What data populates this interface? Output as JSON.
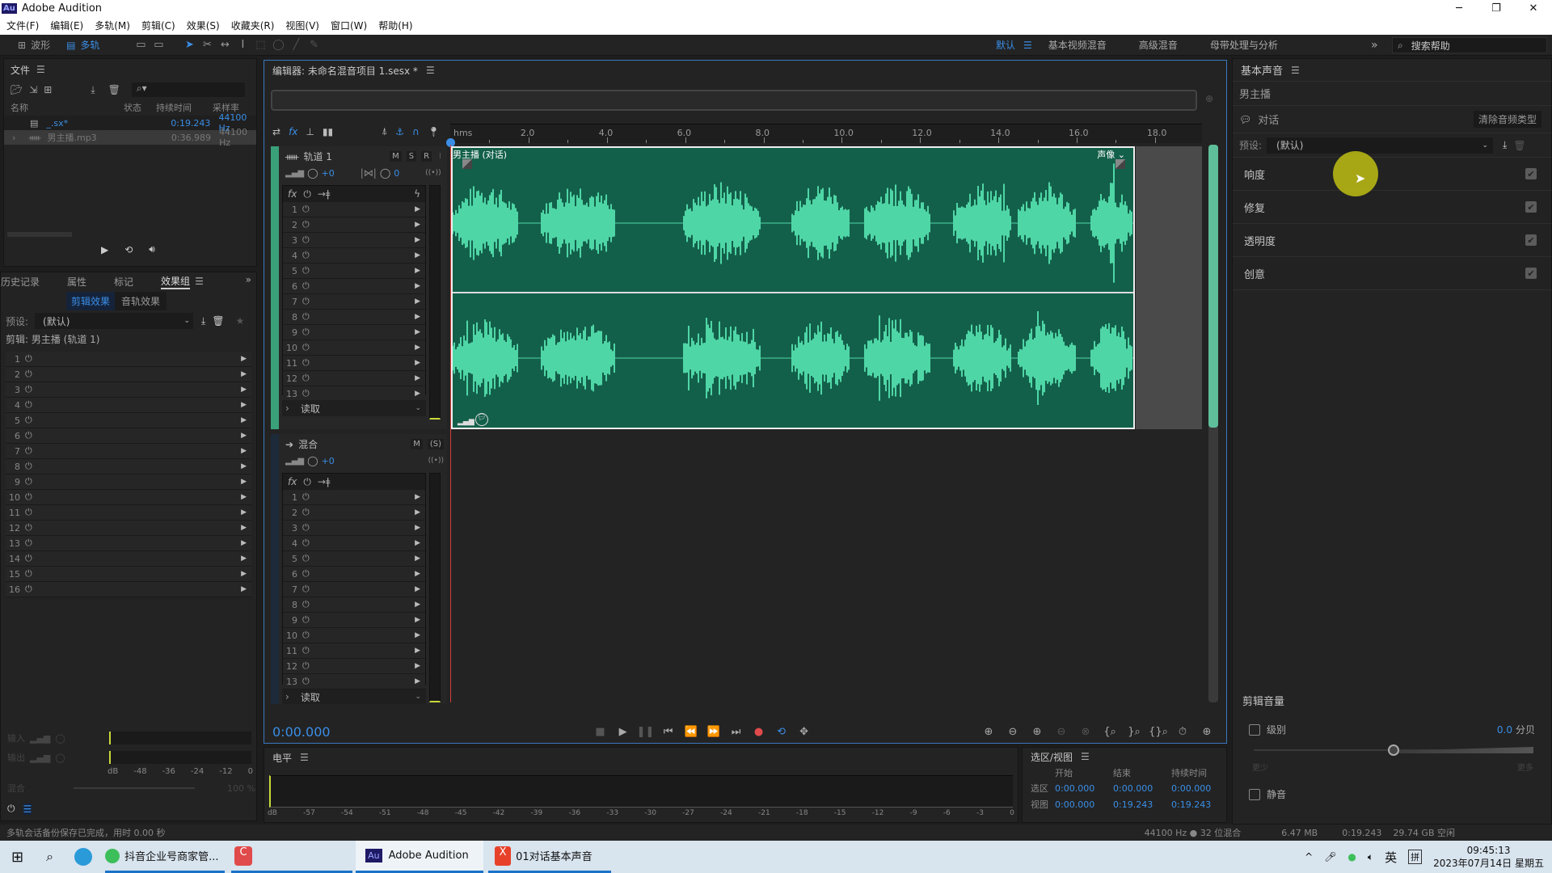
{
  "app": {
    "title": "Adobe Audition",
    "logo": "Au"
  },
  "window_controls": {
    "minimize": "─",
    "restore": "❐",
    "close": "✕"
  },
  "menu": [
    "文件(F)",
    "编辑(E)",
    "多轨(M)",
    "剪辑(C)",
    "效果(S)",
    "收藏夹(R)",
    "视图(V)",
    "窗口(W)",
    "帮助(H)"
  ],
  "toolbar": {
    "waveform_label": "波形",
    "multitrack_label": "多轨",
    "workspaces": [
      "默认",
      "基本视频混音",
      "高级混音",
      "母带处理与分析"
    ],
    "active_workspace": "默认",
    "more": "»",
    "search_placeholder": "搜索帮助"
  },
  "files_panel": {
    "title": "文件",
    "columns": [
      "名称",
      "状态",
      "持续时间",
      "采样率"
    ],
    "items": [
      {
        "name": "_.sx*",
        "duration": "0:19.243",
        "rate": "44100 Hz",
        "type": "multitrack",
        "selected": true
      },
      {
        "name": "男主播.mp3",
        "duration": "0:36.989",
        "rate": "44100 Hz",
        "type": "audio",
        "selected": false
      }
    ]
  },
  "left_tabs": {
    "tabs": [
      "历史记录",
      "属性",
      "标记",
      "效果组"
    ],
    "active": "效果组",
    "subtabs": [
      "剪辑效果",
      "音轨效果"
    ],
    "active_subtab": "剪辑效果",
    "preset_label": "预设:",
    "preset_value": "(默认)",
    "clip_label": "剪辑: 男主播 (轨道 1)",
    "slots": [
      "1",
      "2",
      "3",
      "4",
      "5",
      "6",
      "7",
      "8",
      "9",
      "10",
      "11",
      "12",
      "13",
      "14",
      "15",
      "16"
    ],
    "input_label": "输入",
    "output_label": "输出",
    "mix_label": "混合",
    "mix_value": "100 %",
    "meter_scale": [
      "dB",
      "-48",
      "-36",
      "-24",
      "-12",
      "0"
    ]
  },
  "status_message": "多轨会话备份保存已完成，用时 0.00 秒",
  "editor": {
    "title": "编辑器: 未命名混音项目 1.sesx *",
    "ruler_unit": "hms",
    "ruler_labels": [
      "2.0",
      "4.0",
      "6.0",
      "8.0",
      "10.0",
      "12.0",
      "14.0",
      "16.0",
      "18.0"
    ],
    "track1": {
      "name": "轨道 1",
      "m": "M",
      "s": "S",
      "r": "R",
      "i": "I",
      "volume": "+0",
      "pan": "0",
      "slots": [
        "1",
        "2",
        "3",
        "4",
        "5",
        "6",
        "7",
        "8",
        "9",
        "10",
        "11",
        "12",
        "13"
      ],
      "read_mode": "读取"
    },
    "clip": {
      "name": "男主播 (对话)",
      "pan_label": "声像"
    },
    "mix": {
      "name": "混合",
      "m": "M",
      "s": "(S)",
      "volume": "+0",
      "slots": [
        "1",
        "2",
        "3",
        "4",
        "5",
        "6",
        "7",
        "8",
        "9",
        "10",
        "11",
        "12",
        "13"
      ],
      "read_mode": "读取"
    },
    "time": "0:00.000"
  },
  "levels_panel": {
    "title": "电平",
    "scale": [
      "dB",
      "-57",
      "-54",
      "-51",
      "-48",
      "-45",
      "-42",
      "-39",
      "-36",
      "-33",
      "-30",
      "-27",
      "-24",
      "-21",
      "-18",
      "-15",
      "-12",
      "-9",
      "-6",
      "-3",
      "0"
    ]
  },
  "selection_panel": {
    "title": "选区/视图",
    "columns": [
      "开始",
      "结束",
      "持续时间"
    ],
    "rows": [
      {
        "label": "选区",
        "start": "0:00.000",
        "end": "0:00.000",
        "duration": "0:00.000"
      },
      {
        "label": "视图",
        "start": "0:00.000",
        "end": "0:19.243",
        "duration": "0:19.243"
      }
    ]
  },
  "essential_sound": {
    "title": "基本声音",
    "clip_name": "男主播",
    "type_label": "对话",
    "clear_button": "清除音频类型",
    "preset_label": "预设:",
    "preset_value": "(默认)",
    "sections": [
      {
        "label": "响度",
        "checked": true
      },
      {
        "label": "修复",
        "checked": true
      },
      {
        "label": "透明度",
        "checked": true
      },
      {
        "label": "创意",
        "checked": true
      }
    ],
    "clip_volume_title": "剪辑音量",
    "level_label": "级别",
    "level_checked": false,
    "level_value": "0.0",
    "level_unit": "分贝",
    "level_fraction": 0.5,
    "slider_min_label": "更少",
    "slider_max_label": "更多",
    "mute_label": "静音",
    "mute_checked": false
  },
  "statusbar": {
    "sample_rate": "44100 Hz ● 32 位混合",
    "size": "6.47 MB",
    "duration": "0:19.243",
    "free": "29.74 GB 空闲"
  },
  "taskbar": {
    "items": [
      {
        "label": "抖音企业号商家管..."
      },
      {
        "label": ""
      },
      {
        "label": "Adobe Audition",
        "active": true
      },
      {
        "label": "01对话基本声音"
      }
    ],
    "tray": {
      "ime1": "英",
      "ime2": "拼",
      "time": "09:45:13",
      "date": "2023年07月14日 星期五"
    }
  }
}
